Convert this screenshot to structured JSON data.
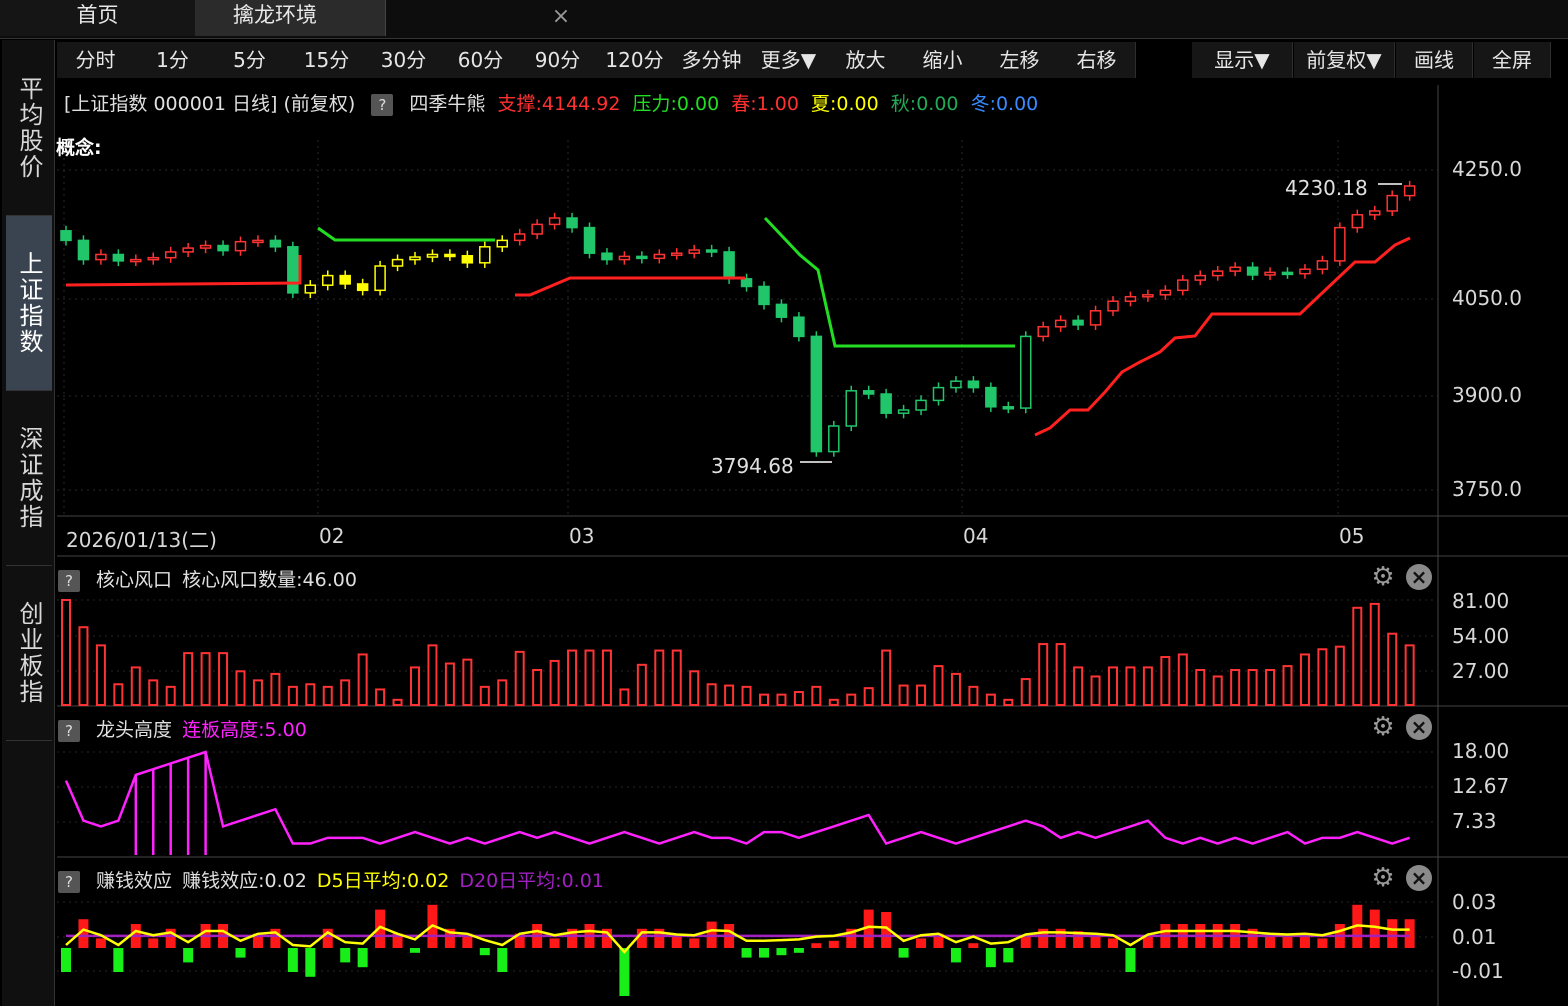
{
  "tabs": {
    "home": "首页",
    "active": "擒龙环境",
    "close": "×"
  },
  "sidebar": [
    {
      "label": "平均股价",
      "active": false
    },
    {
      "label": "上证指数",
      "active": true
    },
    {
      "label": "深证成指",
      "active": false
    },
    {
      "label": "创业板指",
      "active": false
    }
  ],
  "toolbar": [
    "分时",
    "1分",
    "5分",
    "15分",
    "30分",
    "60分",
    "90分",
    "120分",
    "多分钟",
    "更多▼",
    "放大",
    "缩小",
    "左移",
    "右移",
    "显示▼",
    "前复权▼",
    "画线",
    "全屏"
  ],
  "info": {
    "instrument": "[上证指数 000001 日线] (前复权)",
    "help": "?",
    "indicator": "四季牛熊",
    "support": "支撑:4144.92",
    "pressure": "压力:0.00",
    "spring": "春:1.00",
    "summer": "夏:0.00",
    "autumn": "秋:0.00",
    "winter": "冬:0.00",
    "concept": "概念:"
  },
  "colors": {
    "up": "#ff3333",
    "down": "#21c66a",
    "yellow": "#ffff00",
    "red": "#ff2020",
    "green": "#22dd22",
    "magenta": "#ff22ff",
    "purple": "#a020c0",
    "grid": "#3a3a3a"
  },
  "price_axis": {
    "ticks": [
      "4250.0",
      "4050.0",
      "3900.0",
      "3750.0"
    ],
    "high_label": "4230.18",
    "low_label": "3794.68"
  },
  "date_axis": {
    "first": "2026/01/13(二)",
    "months": [
      "02",
      "03",
      "04",
      "05"
    ]
  },
  "panel1": {
    "help": "?",
    "title": "核心风口",
    "value_label": "核心风口数量:46.00",
    "ticks": [
      "81.00",
      "54.00",
      "27.00"
    ]
  },
  "panel2": {
    "help": "?",
    "title": "龙头高度",
    "value_label": "连板高度:5.00",
    "ticks": [
      "18.00",
      "12.67",
      "7.33"
    ]
  },
  "panel3": {
    "help": "?",
    "title": "赚钱效应",
    "value_label": "赚钱效应:0.02",
    "d5": "D5日平均:0.02",
    "d20": "D20日平均:0.01",
    "ticks": [
      "0.03",
      "0.01",
      "-0.01"
    ]
  },
  "chart_data": {
    "type": "bar",
    "categories": [],
    "values": [
      81,
      60,
      46,
      16,
      29,
      19,
      14,
      40,
      40,
      40,
      26,
      19,
      24,
      14,
      16,
      14,
      19,
      39,
      12,
      4,
      29,
      46,
      32,
      35,
      14,
      19,
      41,
      27,
      34,
      42,
      42,
      42,
      12,
      31,
      42,
      42,
      26,
      16,
      15,
      14,
      8,
      8,
      10,
      14,
      4,
      8,
      13,
      42,
      15,
      15,
      30,
      24,
      14,
      8,
      4,
      20,
      47,
      47,
      29,
      22,
      29,
      29,
      29,
      37,
      39,
      27,
      22,
      27,
      27,
      27,
      30,
      39,
      43,
      45,
      75,
      78,
      55,
      46
    ]
  }
}
